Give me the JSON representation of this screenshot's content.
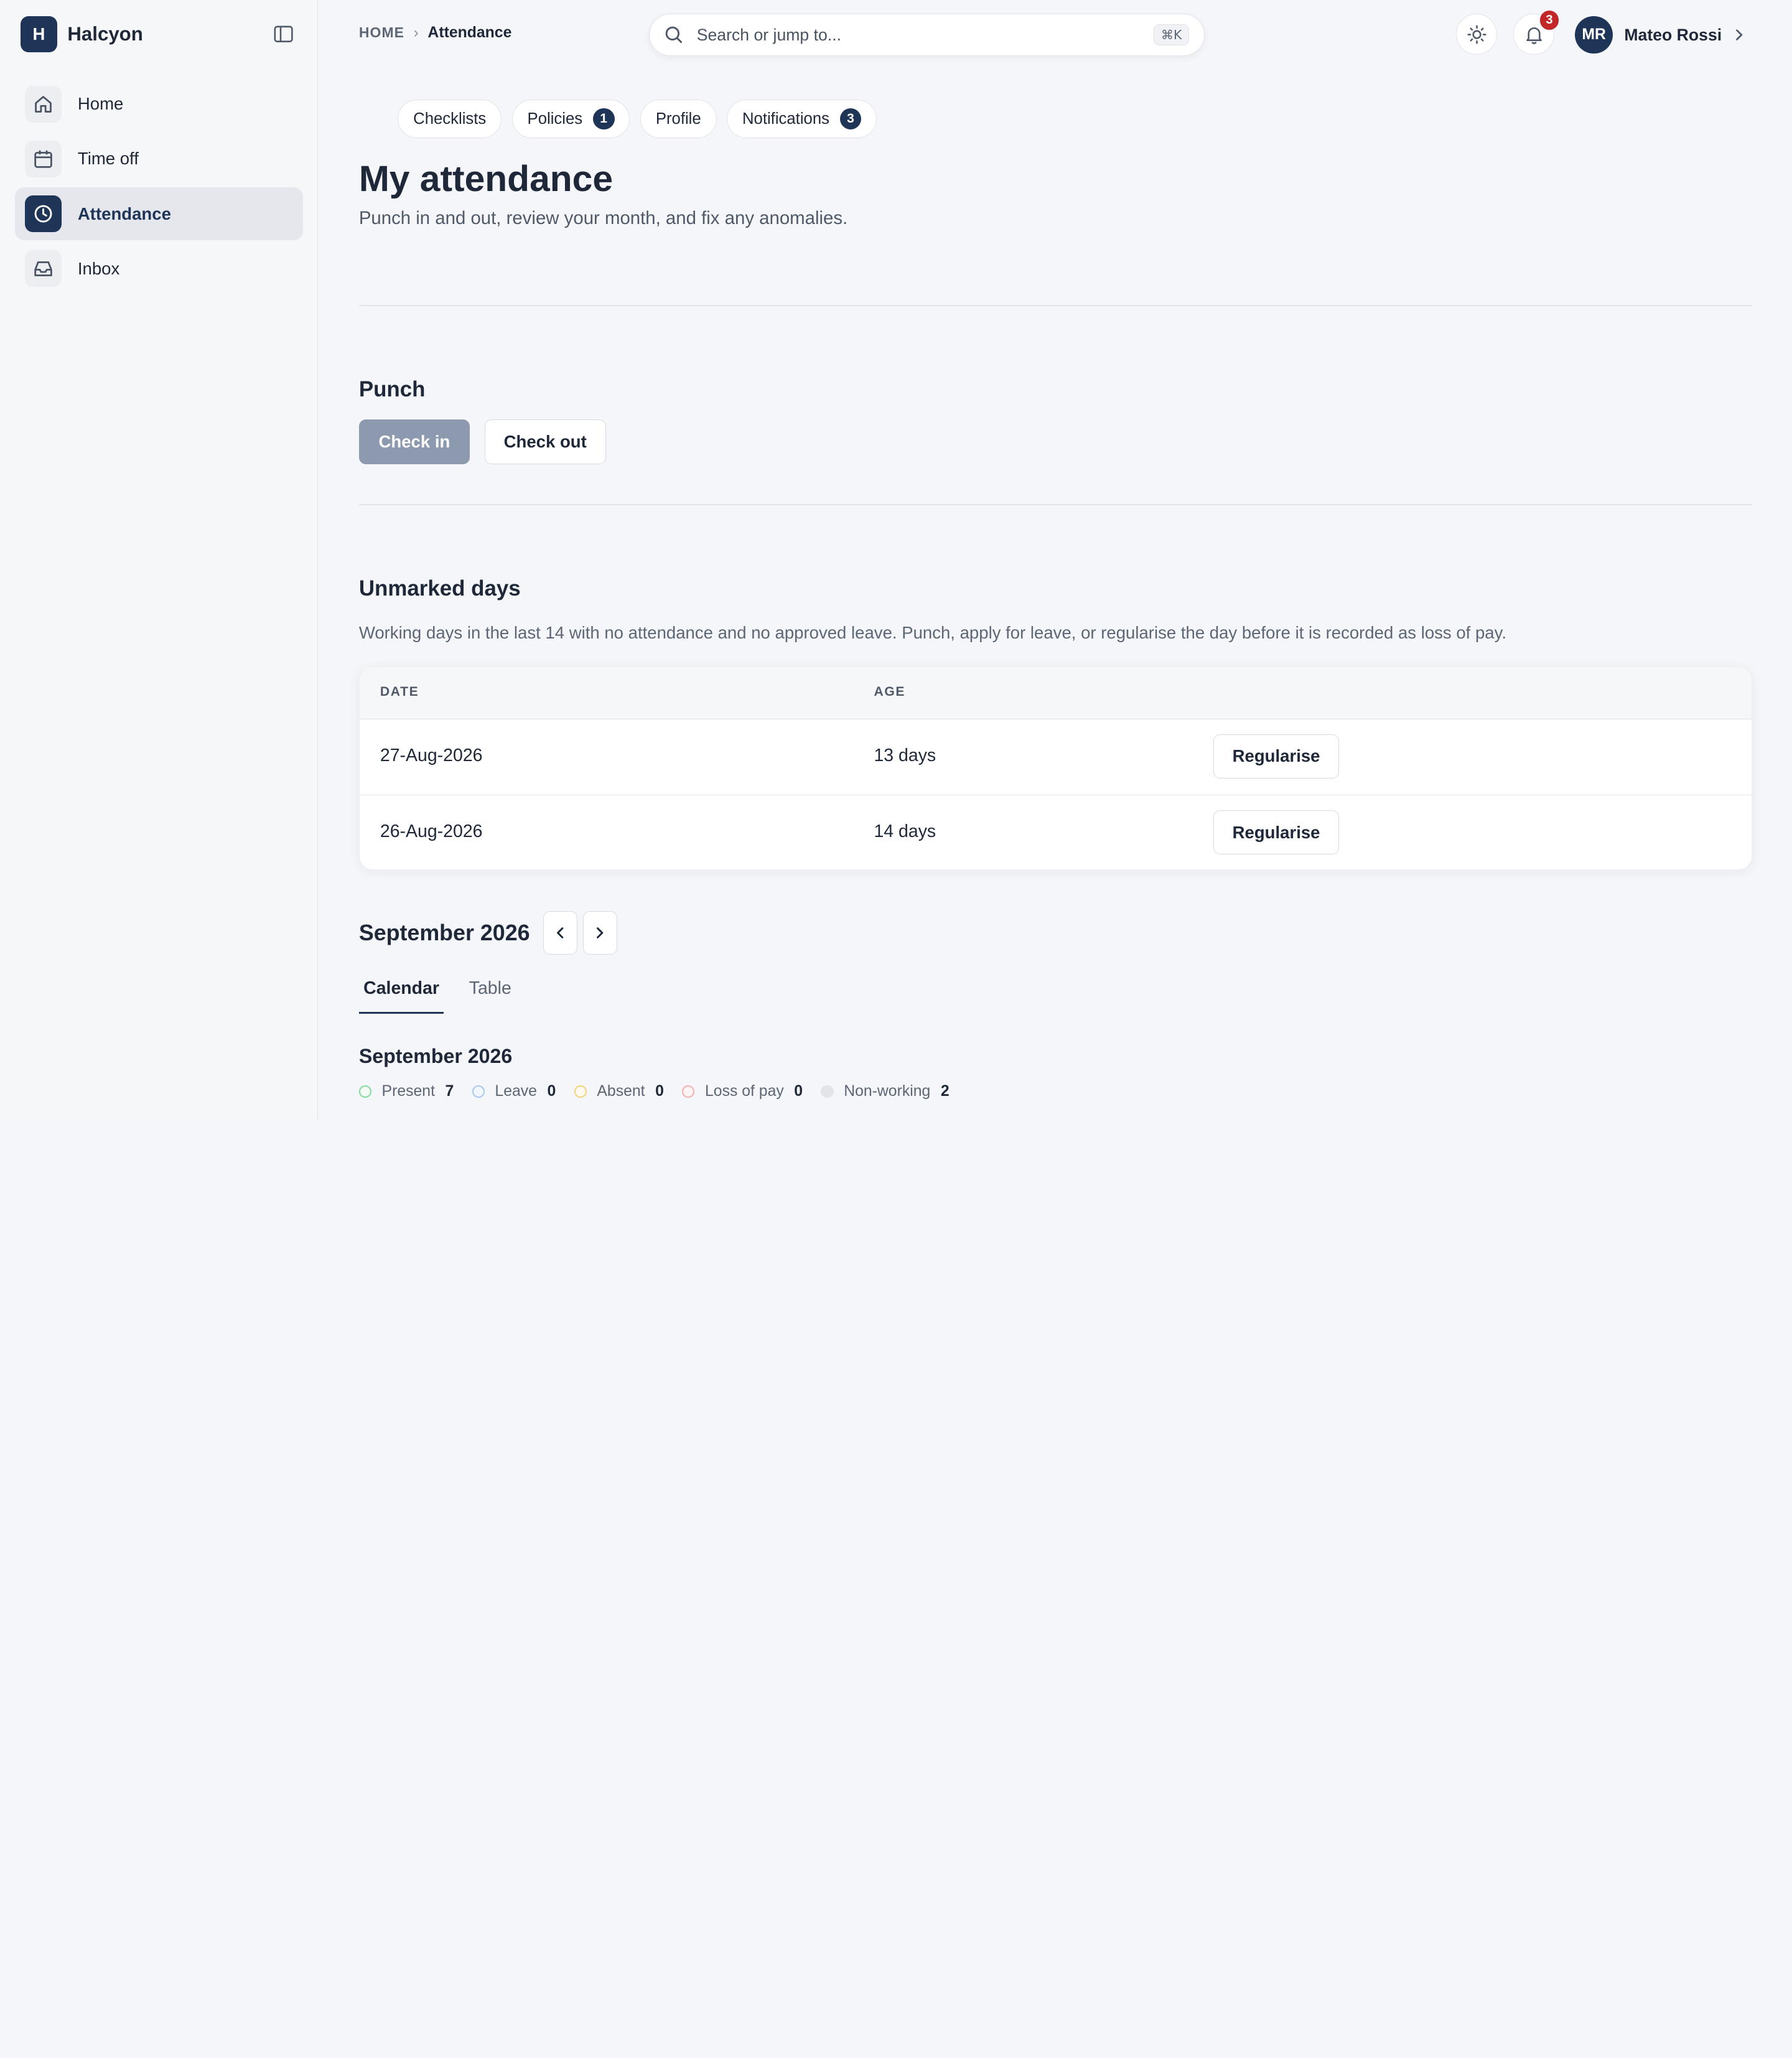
{
  "brand": {
    "logo_letter": "H",
    "name": "Halcyon"
  },
  "sidebar": {
    "items": [
      {
        "label": "Home",
        "icon": "home-icon",
        "active": false
      },
      {
        "label": "Time off",
        "icon": "calendar-icon",
        "active": false
      },
      {
        "label": "Attendance",
        "icon": "clock-icon",
        "active": true
      },
      {
        "label": "Inbox",
        "icon": "inbox-icon",
        "active": false
      }
    ]
  },
  "breadcrumb": {
    "home": "HOME",
    "separator": "›",
    "current": "Attendance"
  },
  "search": {
    "placeholder": "Search or jump to...",
    "shortcut": "⌘K"
  },
  "header": {
    "notifications_count": "3",
    "user": {
      "initials": "MR",
      "name": "Mateo Rossi"
    }
  },
  "chips": [
    {
      "label": "Checklists",
      "count": null
    },
    {
      "label": "Policies",
      "count": "1"
    },
    {
      "label": "Profile",
      "count": null
    },
    {
      "label": "Notifications",
      "count": "3"
    }
  ],
  "page": {
    "title": "My attendance",
    "subtitle": "Punch in and out, review your month, and fix any anomalies."
  },
  "punch": {
    "heading": "Punch",
    "check_in": "Check in",
    "check_out": "Check out"
  },
  "unmarked": {
    "heading": "Unmarked days",
    "description": "Working days in the last 14 with no attendance and no approved leave. Punch, apply for leave, or regularise the day before it is recorded as loss of pay.",
    "columns": [
      "DATE",
      "AGE"
    ],
    "rows": [
      {
        "date": "27-Aug-2026",
        "age": "13 days",
        "action": "Regularise"
      },
      {
        "date": "26-Aug-2026",
        "age": "14 days",
        "action": "Regularise"
      }
    ]
  },
  "month": {
    "title": "September 2026",
    "tabs": [
      {
        "label": "Calendar",
        "active": true
      },
      {
        "label": "Table",
        "active": false
      }
    ],
    "calendar_title": "September 2026",
    "legend": [
      {
        "label": "Present",
        "count": "7",
        "color": "#86d9a0",
        "fill": "#f2fbf5"
      },
      {
        "label": "Leave",
        "count": "0",
        "color": "#a8c8f0",
        "fill": "#f2f7fd"
      },
      {
        "label": "Absent",
        "count": "0",
        "color": "#f3d27a",
        "fill": "#fefaf0"
      },
      {
        "label": "Loss of pay",
        "count": "0",
        "color": "#f4b0b0",
        "fill": "#fef4f4"
      },
      {
        "label": "Non-working",
        "count": "2",
        "color": "#e2e4e8",
        "fill": "#e2e4e8"
      }
    ]
  },
  "colors": {
    "accent": "#1f3558",
    "badge_red": "#c22727",
    "primary_disabled": "#8c99af"
  }
}
